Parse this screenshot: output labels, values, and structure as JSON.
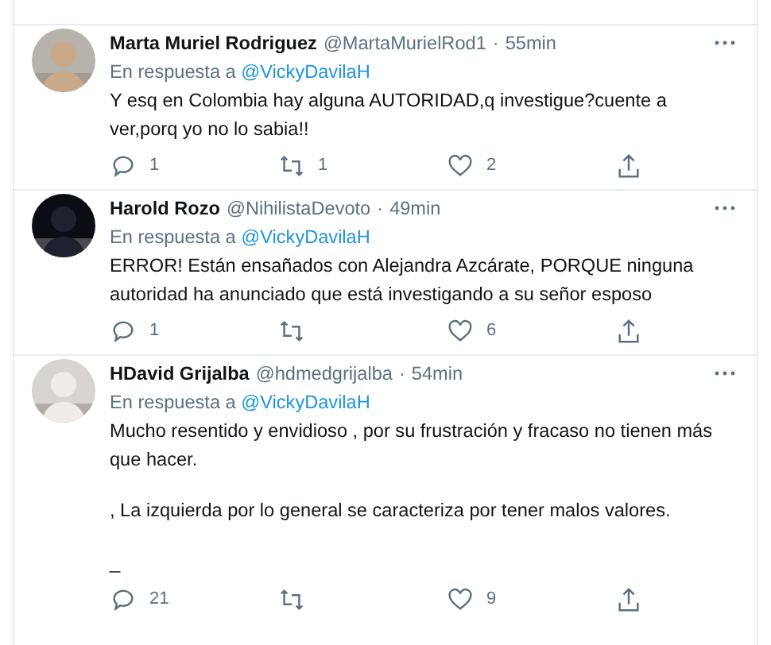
{
  "tweets": [
    {
      "name": "Marta Muriel Rodriguez",
      "handle": "@MartaMurielRod1",
      "separator": "·",
      "time": "55min",
      "reply_prefix": "En respuesta a",
      "reply_to": "@VickyDavilaH",
      "body": [
        "Y esq en Colombia hay alguna AUTORIDAD,q investigue?cuente a ver,porq yo no lo sabia!!"
      ],
      "replies": "1",
      "retweets": "1",
      "likes": "2"
    },
    {
      "name": "Harold Rozo",
      "handle": "@NihilistaDevoto",
      "separator": "·",
      "time": "49min",
      "reply_prefix": "En respuesta a",
      "reply_to": "@VickyDavilaH",
      "body": [
        "ERROR! Están ensañados con Alejandra Azcárate, PORQUE ninguna autoridad ha anunciado que está investigando a su señor esposo"
      ],
      "replies": "1",
      "likes": "6"
    },
    {
      "name": "HDavid Grijalba",
      "handle": "@hdmedgrijalba",
      "separator": "·",
      "time": "54min",
      "reply_prefix": "En respuesta a",
      "reply_to": "@VickyDavilaH",
      "body": [
        "Mucho resentido y envidioso , por su frustración y fracaso no tienen más que hacer.",
        ", La izquierda por lo general se caracteriza por tener malos valores.",
        "_"
      ],
      "replies": "21",
      "likes": "9"
    }
  ]
}
